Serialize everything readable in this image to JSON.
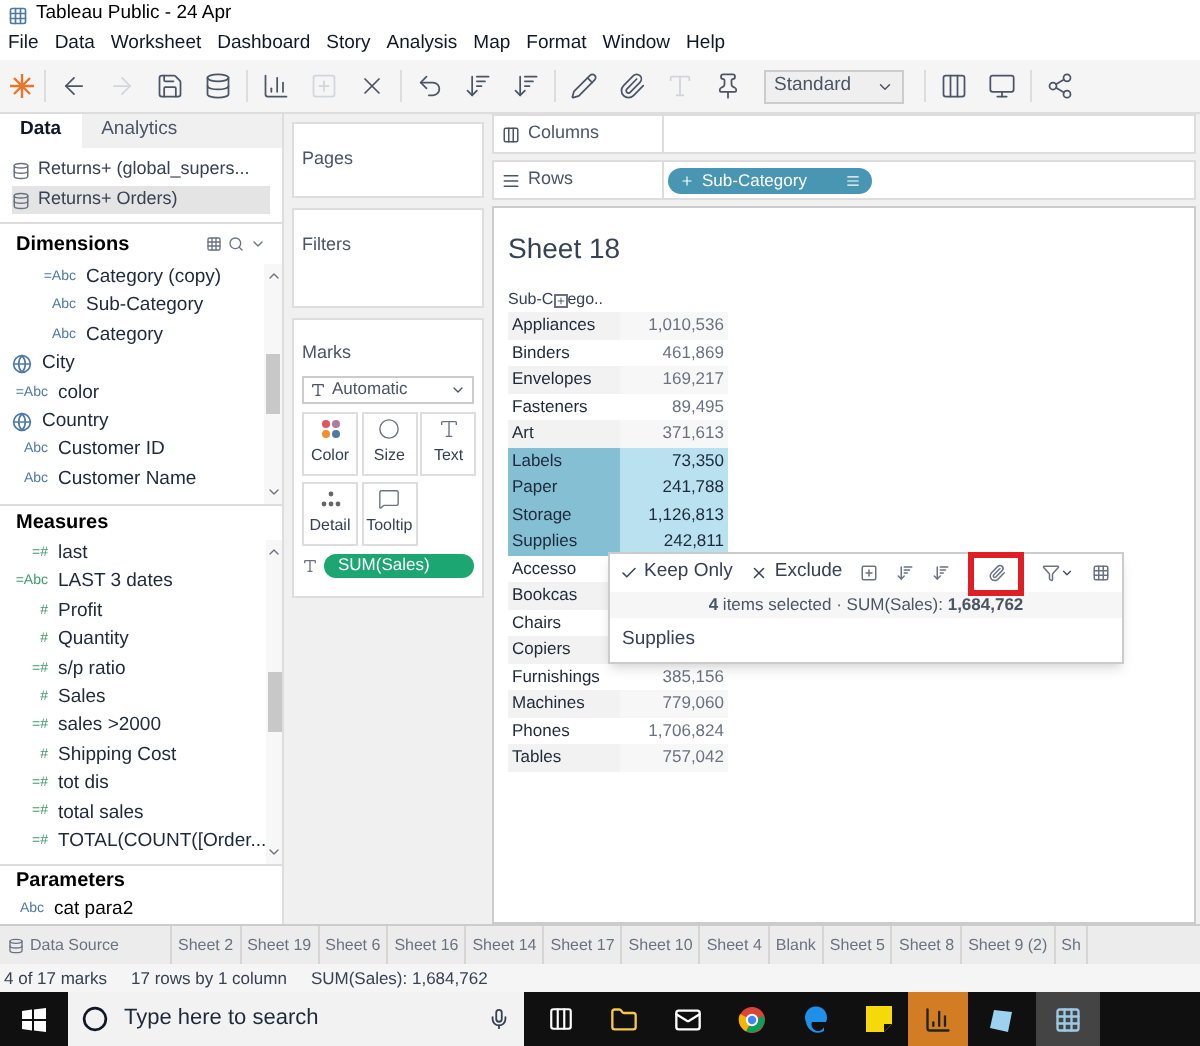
{
  "window": {
    "title": "Tableau Public - 24 Apr"
  },
  "menu": [
    "File",
    "Data",
    "Worksheet",
    "Dashboard",
    "Story",
    "Analysis",
    "Map",
    "Format",
    "Window",
    "Help"
  ],
  "toolbar": {
    "fit_dropdown": "Standard"
  },
  "side_tabs": [
    {
      "label": "Data",
      "selected": true
    },
    {
      "label": "Analytics",
      "selected": false
    }
  ],
  "data_sources": [
    {
      "name": "Returns+ (global_supers...",
      "selected": false
    },
    {
      "name": "Returns+ Orders)",
      "selected": true
    }
  ],
  "dimensions": {
    "title": "Dimensions",
    "items": [
      {
        "kind": "type",
        "icon": "=Abc",
        "name": "Category (copy)",
        "nested": true
      },
      {
        "kind": "type",
        "icon": "Abc",
        "name": "Sub-Category",
        "nested": true
      },
      {
        "kind": "type",
        "icon": "Abc",
        "name": "Category",
        "nested": true
      },
      {
        "kind": "geo",
        "name": "City",
        "nested": false
      },
      {
        "kind": "type",
        "icon": "=Abc",
        "name": "color",
        "nested": false
      },
      {
        "kind": "geo",
        "name": "Country",
        "nested": false
      },
      {
        "kind": "type",
        "icon": "Abc",
        "name": "Customer ID",
        "nested": false
      },
      {
        "kind": "type",
        "icon": "Abc",
        "name": "Customer Name",
        "nested": false
      }
    ]
  },
  "measures": {
    "title": "Measures",
    "items": [
      {
        "icon": "=#",
        "name": "last"
      },
      {
        "icon": "=Abc",
        "name": "LAST 3 dates"
      },
      {
        "icon": "#",
        "name": "Profit"
      },
      {
        "icon": "#",
        "name": "Quantity"
      },
      {
        "icon": "=#",
        "name": "s/p ratio"
      },
      {
        "icon": "#",
        "name": "Sales"
      },
      {
        "icon": "=#",
        "name": "sales >2000"
      },
      {
        "icon": "#",
        "name": "Shipping Cost"
      },
      {
        "icon": "=#",
        "name": "tot dis"
      },
      {
        "icon": "=#",
        "name": "total sales"
      },
      {
        "icon": "=#",
        "name": "TOTAL(COUNT([Order..."
      }
    ]
  },
  "parameters": {
    "title": "Parameters",
    "items": [
      {
        "icon": "Abc",
        "name": "cat para2"
      }
    ]
  },
  "pages": {
    "title": "Pages"
  },
  "filters": {
    "title": "Filters"
  },
  "marks": {
    "title": "Marks",
    "mark_type": "Automatic",
    "buttons": [
      {
        "label": "Color",
        "kind": "color"
      },
      {
        "label": "Size",
        "kind": "size"
      },
      {
        "label": "Text",
        "kind": "text"
      },
      {
        "label": "Detail",
        "kind": "detail"
      },
      {
        "label": "Tooltip",
        "kind": "tooltip"
      }
    ],
    "pill": "SUM(Sales)"
  },
  "shelves": {
    "columns": "Columns",
    "rows": "Rows",
    "rows_pill": "Sub-Category"
  },
  "sheet": {
    "title": "Sheet 18",
    "header_start": "Sub-C",
    "header_end": "ego..",
    "rows": [
      {
        "name": "Appliances",
        "value": "1,010,536",
        "selected": false
      },
      {
        "name": "Binders",
        "value": "461,869",
        "selected": false
      },
      {
        "name": "Envelopes",
        "value": "169,217",
        "selected": false
      },
      {
        "name": "Fasteners",
        "value": "89,495",
        "selected": false
      },
      {
        "name": "Art",
        "value": "371,613",
        "selected": false
      },
      {
        "name": "Labels",
        "value": "73,350",
        "selected": true
      },
      {
        "name": "Paper",
        "value": "241,788",
        "selected": true
      },
      {
        "name": "Storage",
        "value": "1,126,813",
        "selected": true
      },
      {
        "name": "Supplies",
        "value": "242,811",
        "selected": true
      },
      {
        "name": "Accesso",
        "selected": false
      },
      {
        "name": "Bookcas",
        "selected": false
      },
      {
        "name": "Chairs",
        "selected": false
      },
      {
        "name": "Copiers",
        "selected": false
      },
      {
        "name": "Furnishings",
        "value": "385,156",
        "selected": false
      },
      {
        "name": "Machines",
        "value": "779,060",
        "selected": false
      },
      {
        "name": "Phones",
        "value": "1,706,824",
        "selected": false
      },
      {
        "name": "Tables",
        "value": "757,042",
        "selected": false
      }
    ]
  },
  "tooltip": {
    "keep_only": "Keep Only",
    "exclude": "Exclude",
    "summary": "**4** items selected · SUM(Sales): **1,684,762**",
    "item": "Supplies"
  },
  "sheet_tabs": [
    "Data Source",
    "Sheet 2",
    "Sheet 19",
    "Sheet 6",
    "Sheet 16",
    "Sheet 14",
    "Sheet 17",
    "Sheet 10",
    "Sheet 4",
    "Blank",
    "Sheet 5",
    "Sheet 8",
    "Sheet 9 (2)",
    "Sh"
  ],
  "status_bar": [
    "4 of 17 marks",
    "17 rows by 1 column",
    "SUM(Sales): 1,684,762"
  ],
  "taskbar": {
    "search_placeholder": "Type here to search"
  }
}
